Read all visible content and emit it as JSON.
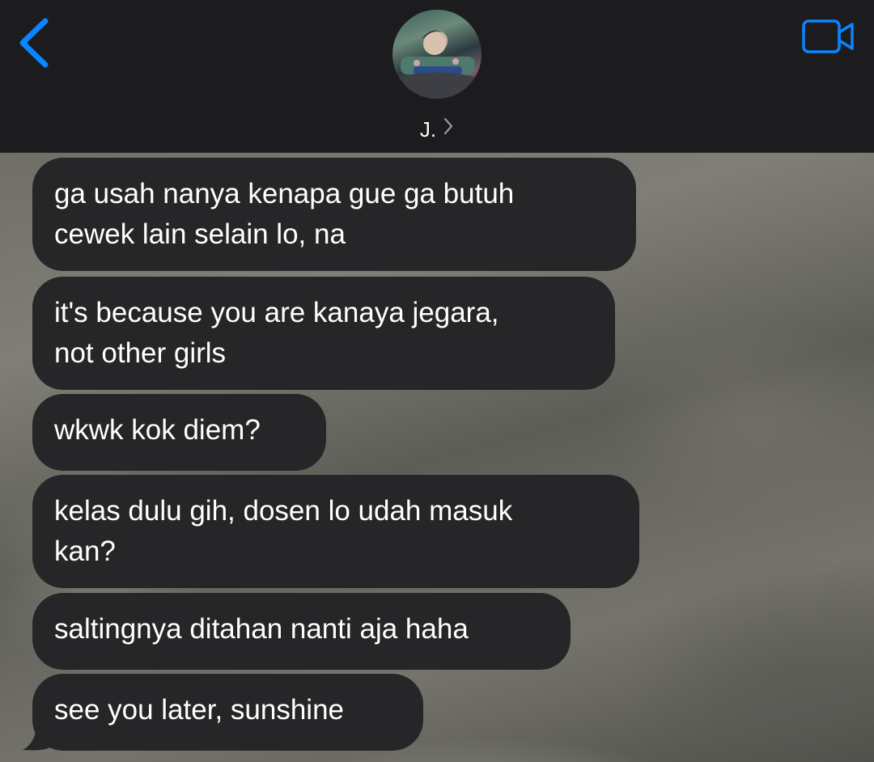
{
  "header": {
    "contact_name": "J.",
    "back_icon": "chevron-left-icon",
    "video_icon": "video-camera-icon",
    "chevron_icon": "chevron-right-icon",
    "accent_color": "#0a84ff"
  },
  "messages": [
    {
      "direction": "incoming",
      "text": "ga usah nanya kenapa gue ga butuh\ncewek lain selain lo, na"
    },
    {
      "direction": "incoming",
      "text": "it's because you are kanaya jegara,\nnot other girls"
    },
    {
      "direction": "incoming",
      "text": "wkwk kok diem?"
    },
    {
      "direction": "incoming",
      "text": "kelas dulu gih, dosen lo udah masuk\nkan?"
    },
    {
      "direction": "incoming",
      "text": "saltingnya ditahan nanti aja haha"
    },
    {
      "direction": "incoming",
      "text": "see you later, sunshine"
    }
  ]
}
